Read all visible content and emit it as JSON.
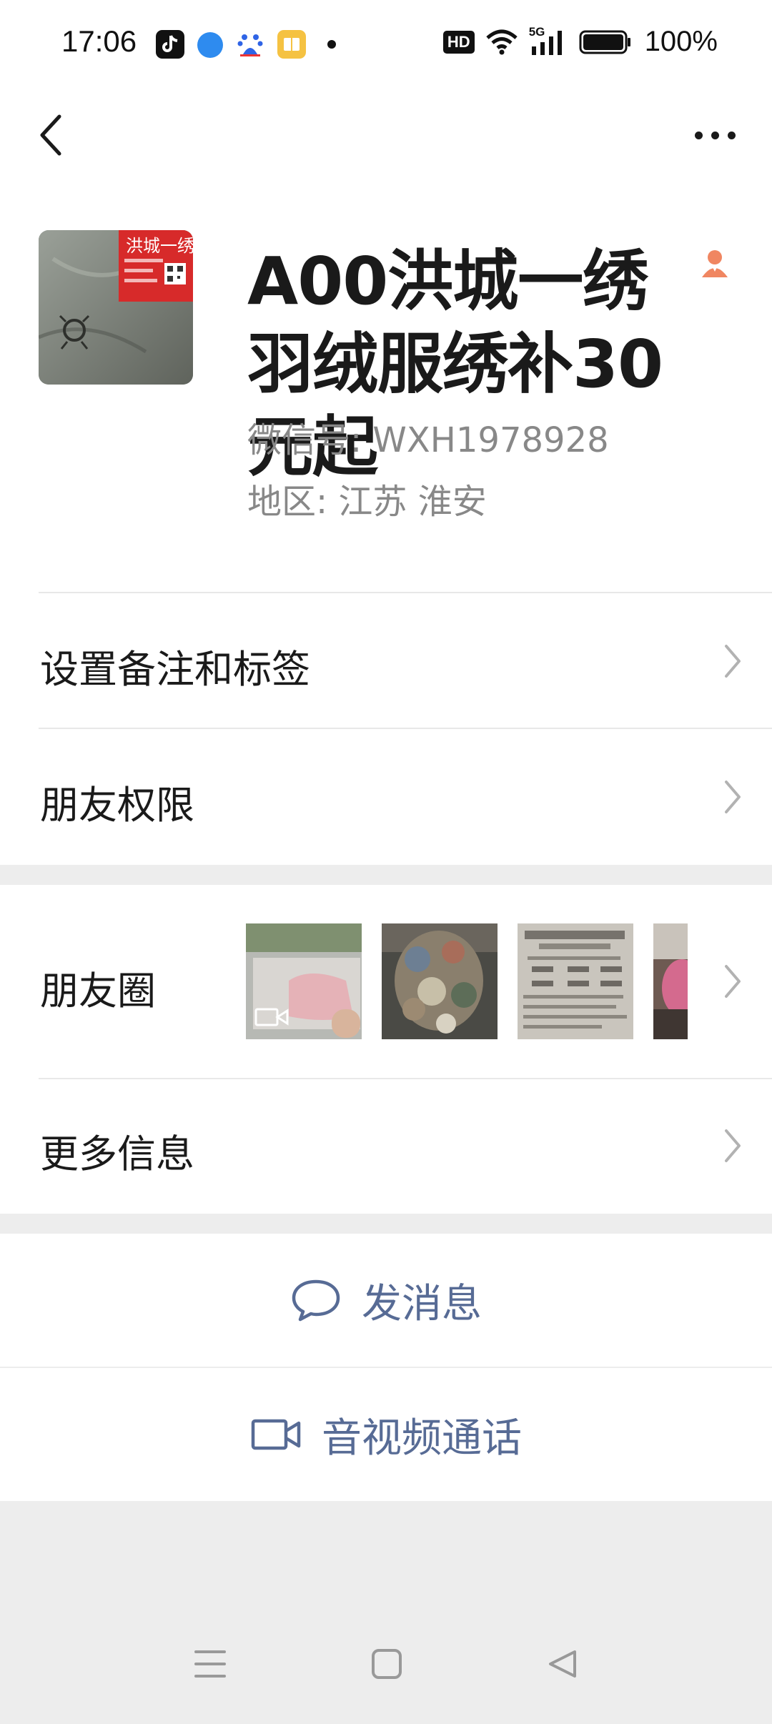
{
  "status_bar": {
    "time": "17:06",
    "hd": "HD",
    "network": "5G",
    "battery": "100%"
  },
  "header": {
    "back_icon": "chevron-left-icon",
    "more_icon": "more-icon"
  },
  "profile": {
    "name": "A00洪城一绣羽绒服绣补30元起",
    "wechat_id": "微信号: WXH1978928",
    "region": "地区: 江苏  淮安",
    "avatar_text": "洪城一绣"
  },
  "rows": {
    "remark": "设置备注和标签",
    "permissions": "朋友权限",
    "moments": "朋友圈",
    "more_info": "更多信息"
  },
  "actions": {
    "message": "发消息",
    "call": "音视频通话"
  },
  "colors": {
    "link": "#576b95",
    "background": "#ededed"
  }
}
